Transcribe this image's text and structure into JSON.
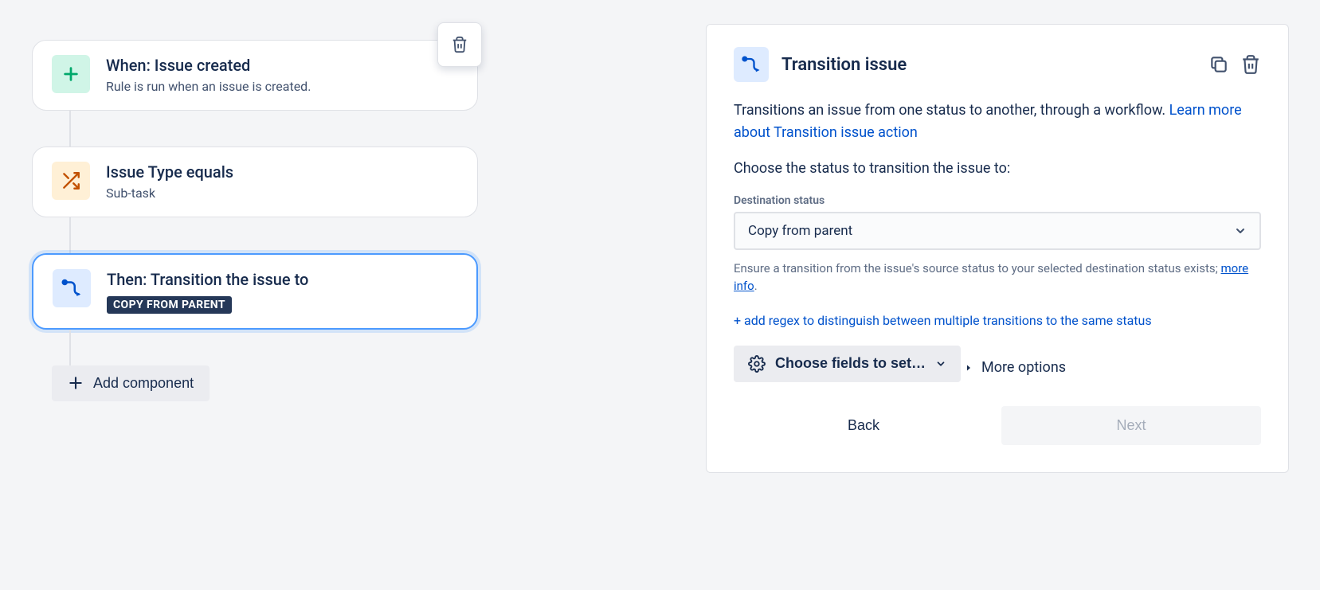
{
  "rule": {
    "trigger": {
      "title": "When: Issue created",
      "subtitle": "Rule is run when an issue is created."
    },
    "condition": {
      "title": "Issue Type equals",
      "subtitle": "Sub-task"
    },
    "action": {
      "title": "Then: Transition the issue to",
      "chip": "COPY FROM PARENT"
    },
    "add_component": "Add component"
  },
  "panel": {
    "title": "Transition issue",
    "description_pre": "Transitions an issue from one status to another, through a workflow. ",
    "description_link": "Learn more about Transition issue action",
    "prompt": "Choose the status to transition the issue to:",
    "dest_label": "Destination status",
    "dest_value": "Copy from parent",
    "helper_pre": "Ensure a transition from the issue's source status to your selected destination status exists; ",
    "helper_link": "more info",
    "add_regex": "+ add regex to distinguish between multiple transitions to the same status",
    "choose_fields": "Choose fields to set…",
    "more_options": "More options",
    "back": "Back",
    "next": "Next"
  }
}
